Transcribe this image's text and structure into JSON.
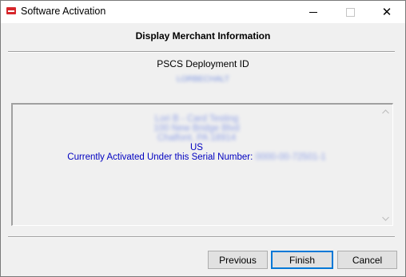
{
  "window": {
    "title": "Software Activation",
    "icon": "app-icon",
    "controls": {
      "minimize": "minimize-icon",
      "maximize": "maximize-icon",
      "close_glyph": "✕"
    }
  },
  "header": {
    "title": "Display Merchant Information"
  },
  "deployment": {
    "label": "PSCS Deployment ID",
    "value": "LORBECHALT"
  },
  "merchant": {
    "name": "Lori B - Card Testing",
    "address_line": "100 New Bridge Blvd",
    "city_state_zip": "Chalfont, PA 18914",
    "country": "US",
    "serial_label": "Currently Activated Under this Serial Number:",
    "serial_value": "0000-00-72501-1"
  },
  "buttons": {
    "previous": "Previous",
    "finish": "Finish",
    "cancel": "Cancel"
  },
  "colors": {
    "accent": "#0078d7",
    "info_text": "#0000c0",
    "app_icon": "#d6262b"
  }
}
